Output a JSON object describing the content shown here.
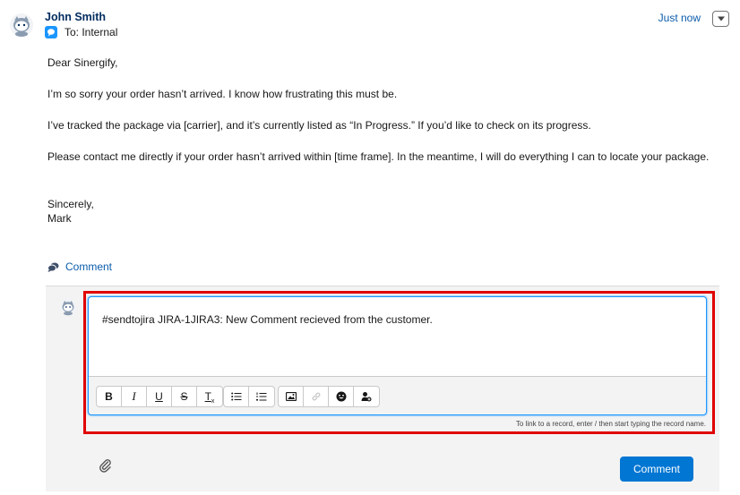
{
  "post": {
    "author": "John Smith",
    "audience": "To: Internal",
    "timestamp": "Just now",
    "body": {
      "greeting": "Dear Sinergify,",
      "p1": "I’m so sorry your order hasn’t arrived. I know how frustrating this must be.",
      "p2": "I’ve tracked the package via [carrier], and it’s currently listed as “In Progress.” If you’d like to check on its progress.",
      "p3": "Please contact me directly if your order hasn’t arrived within [time frame]. In the meantime, I will do everything I can to locate your package.",
      "closing": "Sincerely,",
      "signature": "Mark"
    },
    "comment_action": "Comment"
  },
  "composer": {
    "text": "#sendtojira JIRA-1JIRA3: New Comment recieved from the customer.",
    "toolbar": {
      "bold": "B",
      "italic": "I",
      "underline": "U",
      "strike": "S",
      "clear": "T"
    },
    "hint": "To link to a record, enter / then start typing the record name.",
    "submit_label": "Comment"
  },
  "colors": {
    "brand": "#0176d3",
    "link": "#0b5cab",
    "highlight": "#e00000"
  }
}
